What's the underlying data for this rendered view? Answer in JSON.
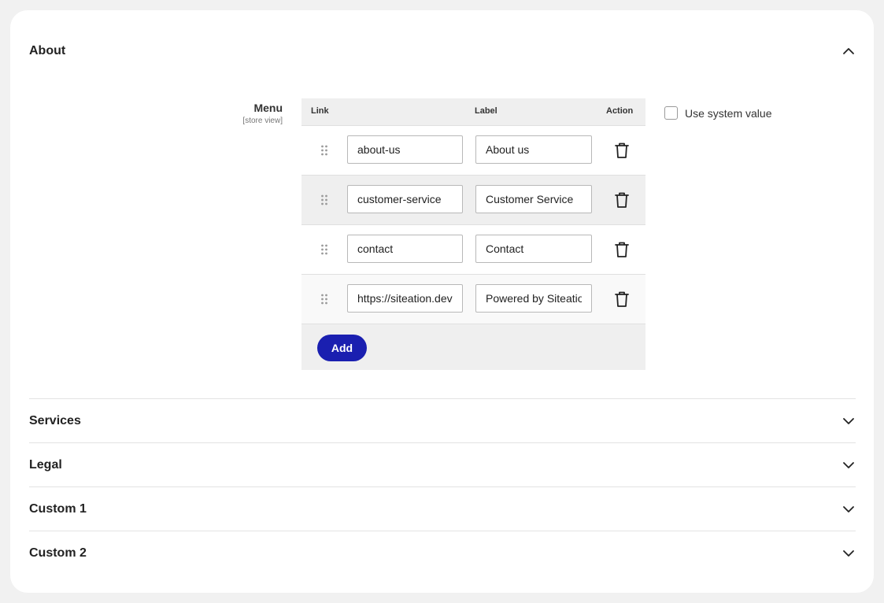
{
  "sections": {
    "about": {
      "title": "About",
      "expanded": true
    },
    "services": {
      "title": "Services"
    },
    "legal": {
      "title": "Legal"
    },
    "custom1": {
      "title": "Custom 1"
    },
    "custom2": {
      "title": "Custom 2"
    }
  },
  "field": {
    "label": "Menu",
    "scope": "[store view]"
  },
  "grid": {
    "columns": {
      "link": "Link",
      "label": "Label",
      "action": "Action"
    },
    "rows": [
      {
        "link": "about-us",
        "label": "About us"
      },
      {
        "link": "customer-service",
        "label": "Customer Service"
      },
      {
        "link": "contact",
        "label": "Contact"
      },
      {
        "link": "https://siteation.dev",
        "label": "Powered by Siteation"
      }
    ],
    "add_label": "Add"
  },
  "system_value": {
    "label": "Use system value",
    "checked": false
  },
  "colors": {
    "accent": "#1a1fb0",
    "background": "#f1f1f1",
    "card": "#ffffff"
  },
  "icons": {
    "collapse": "chevron-up-icon",
    "expand": "chevron-down-icon",
    "drag": "drag-handle-icon",
    "delete": "trash-icon"
  }
}
